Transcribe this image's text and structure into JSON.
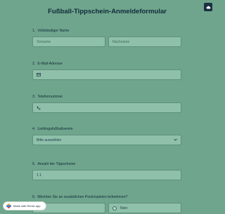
{
  "form": {
    "title": "Fußball-Tippschein-Anmeldeformular"
  },
  "questions": {
    "q1": {
      "number": "1.",
      "label": "Vollständiger Name",
      "first_placeholder": "Vorname",
      "last_placeholder": "Nachname"
    },
    "q2": {
      "number": "2.",
      "label": "E-Mail-Adresse",
      "icon": "envelope-icon"
    },
    "q3": {
      "number": "3.",
      "label": "Telefonnummer",
      "icon": "phone-icon"
    },
    "q4": {
      "number": "4.",
      "label": "Lieblingsfußballverein",
      "selected": "Bitte auswählen"
    },
    "q5": {
      "number": "5.",
      "label": "Anzahl der Tippscheine",
      "value": "1 1"
    },
    "q6": {
      "number": "6.",
      "label": "Möchten Sie an zusätzlichen Pools/spielen teilnehmen?",
      "option_no": "Nein"
    }
  },
  "badge": {
    "text": "Made with Remix app"
  },
  "colors": {
    "background": "#6fa58c",
    "field": "#8fc0aa",
    "text": "#0f2a3a",
    "corner_button": "#1b3042"
  }
}
